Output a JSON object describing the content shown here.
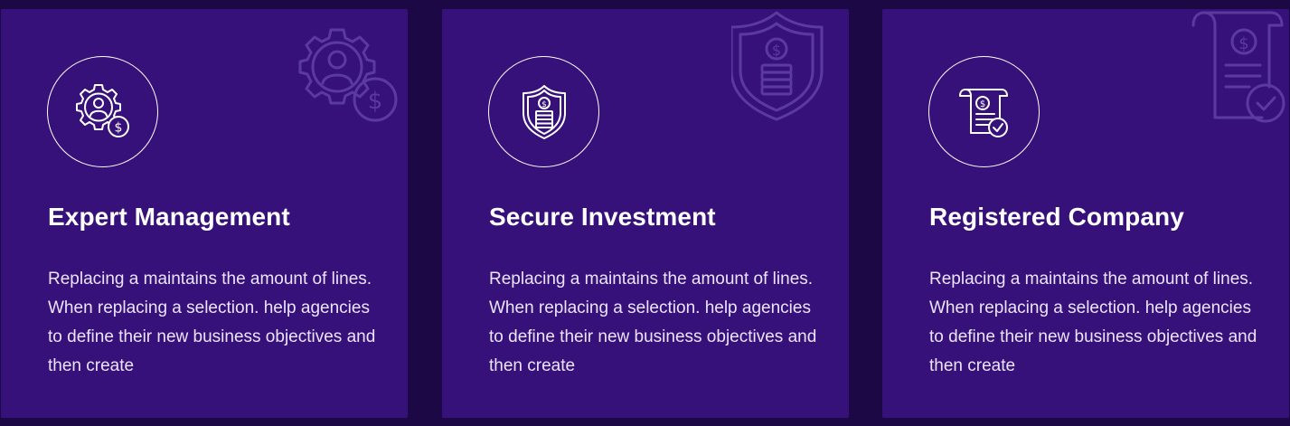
{
  "colors": {
    "page_background": "#1d0846",
    "card_background": "#37117a",
    "text_primary": "#ffffff",
    "text_secondary": "#ebe4fb"
  },
  "features": [
    {
      "icon": "gear-user-dollar-icon",
      "title": "Expert Management",
      "description": "Replacing a maintains the amount of lines. When replacing a selection. help agencies to define their new business objectives and then create"
    },
    {
      "icon": "shield-dollar-coins-icon",
      "title": "Secure Investment",
      "description": "Replacing a maintains the amount of lines. When replacing a selection. help agencies to define their new business objectives and then create"
    },
    {
      "icon": "document-dollar-check-icon",
      "title": "Registered Company",
      "description": "Replacing a maintains the amount of lines. When replacing a selection. help agencies to define their new business objectives and then create"
    }
  ]
}
